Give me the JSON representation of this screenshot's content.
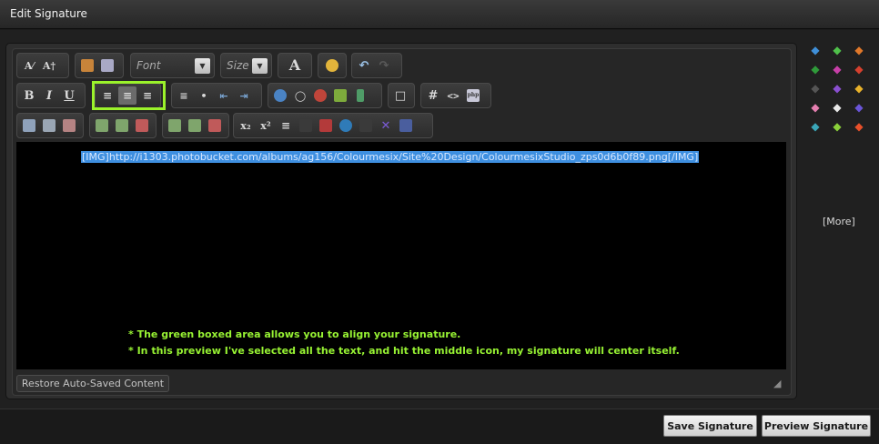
{
  "window": {
    "title": "Edit Signature"
  },
  "toolbar": {
    "font_label": "Font",
    "size_label": "Size",
    "font_color_glyph": "A",
    "bold_glyph": "B",
    "italic_glyph": "I",
    "underline_glyph": "U",
    "subscript_glyph": "x₂",
    "superscript_glyph": "x²",
    "hash_glyph": "#",
    "code_glyph": "<>",
    "php_glyph": "php",
    "active_alignment": "center"
  },
  "editor": {
    "content": "[IMG]http://i1303.photobucket.com/albums/ag156/Colourmesix/Site%20Design/ColourmesixStudio_zps0d6b0f89.png[/IMG]",
    "note_1": "* The green boxed area allows you to align your signature.",
    "note_2": "* In this preview I've selected all the text, and hit the middle icon, my signature will center itself.",
    "restore_label": "Restore Auto-Saved Content",
    "highlight_color": "#9bf22b",
    "selection_color": "#3e8fe0"
  },
  "emoticons": {
    "icons": [
      "bird-blue-icon",
      "bird-green-icon",
      "bird-orange-icon",
      "bird-green-dark-icon",
      "bird-magenta-icon",
      "bird-red-icon",
      "bird-black-icon",
      "bird-purple-icon",
      "bird-yellow-icon",
      "bird-pink-icon",
      "bird-white-icon",
      "bird-violet-icon",
      "bird-teal-icon",
      "bird-lime-icon",
      "bird-fire-icon"
    ],
    "more_label": "[More]"
  },
  "footer": {
    "save_label": "Save Signature",
    "preview_label": "Preview Signature"
  }
}
